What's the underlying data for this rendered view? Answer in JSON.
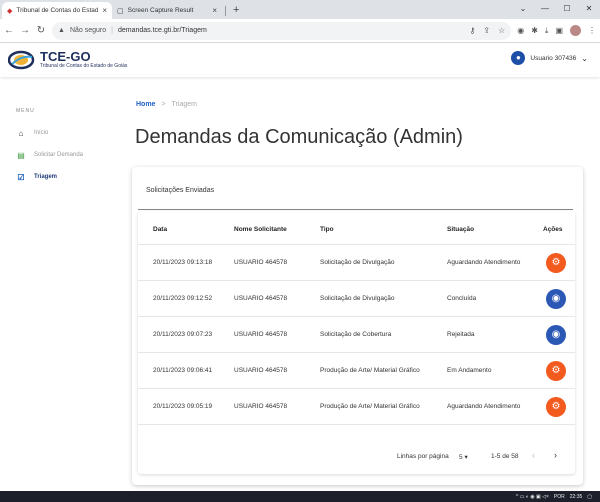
{
  "browser": {
    "tabs": [
      {
        "title": "Tribunal de Contas do Estado de",
        "active": true
      },
      {
        "title": "Screen Capture Result",
        "active": false
      }
    ],
    "address": {
      "security": "Não seguro",
      "url": "demandas.tce.gti.br/Triagem"
    }
  },
  "header": {
    "logo_title": "TCE-GO",
    "logo_subtitle": "Tribunal de Contas do Estado de Goiás",
    "user_name": "Usuario 307436"
  },
  "sidebar": {
    "menu_label": "MENU",
    "items": [
      {
        "label": "Início",
        "icon": "home-icon"
      },
      {
        "label": "Solicitar Demanda",
        "icon": "clipboard-icon"
      },
      {
        "label": "Triagem",
        "icon": "checkbox-icon"
      }
    ]
  },
  "breadcrumb": {
    "home": "Home",
    "separator": ">",
    "current": "Triagem"
  },
  "page_title": "Demandas da Comunicação (Admin)",
  "card": {
    "title": "Solicitações Enviadas",
    "columns": [
      "Data",
      "Nome Solicitante",
      "Tipo",
      "Situação",
      "Ações"
    ],
    "rows": [
      {
        "data": "20/11/2023 09:13:18",
        "nome": "USUARIO 464578",
        "tipo": "Solicitação de Divulgação",
        "situacao": "Aguardando Atendimento",
        "acao": "gear-icon"
      },
      {
        "data": "20/11/2023 09:12:52",
        "nome": "USUARIO 464578",
        "tipo": "Solicitação de Divulgação",
        "situacao": "Concluída",
        "acao": "eye-icon"
      },
      {
        "data": "20/11/2023 09:07:23",
        "nome": "USUARIO 464578",
        "tipo": "Solicitação de Cobertura",
        "situacao": "Rejeitada",
        "acao": "eye-icon"
      },
      {
        "data": "20/11/2023 09:06:41",
        "nome": "USUARIO 464578",
        "tipo": "Produção de Arte/ Material Gráfico",
        "situacao": "Em Andamento",
        "acao": "gear-icon"
      },
      {
        "data": "20/11/2023 09:05:19",
        "nome": "USUARIO 464578",
        "tipo": "Produção de Arte/ Material Gráfico",
        "situacao": "Aguardando Atendimento",
        "acao": "gear-icon"
      }
    ],
    "pagination": {
      "rows_label": "Linhas por página",
      "rows_per_page": "5",
      "range": "1-5 de 58"
    }
  },
  "taskbar": {
    "lang": "POR",
    "time": "22:35"
  },
  "colors": {
    "brand_blue": "#1e3c78",
    "gear_orange": "#f25a1e",
    "eye_blue": "#2b57b5"
  }
}
